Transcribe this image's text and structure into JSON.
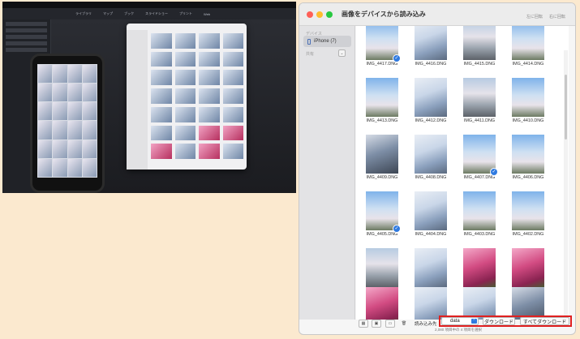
{
  "desk_photo": {
    "toolbar_items": [
      "ライブラリ",
      "マップ",
      "ブック",
      "スライドショー",
      "プリント",
      "Web"
    ]
  },
  "dialog": {
    "title": "画像をデバイスから読み込み",
    "rotate_left": "左に回転",
    "rotate_right": "右に回転",
    "sidebar": {
      "heading": "デバイス",
      "device_label": "iPhone (7)",
      "share_heading": "共有",
      "share_button": "⌄"
    },
    "photos": [
      {
        "name": "IMG_4417.DNG",
        "style": "tn-sky",
        "checked": true
      },
      {
        "name": "IMG_4416.DNG",
        "style": "tn-blossom",
        "checked": false
      },
      {
        "name": "IMG_4415.DNG",
        "style": "tn-street",
        "checked": false
      },
      {
        "name": "IMG_4414.DNG",
        "style": "tn-sky",
        "checked": false
      },
      {
        "name": "IMG_4413.DNG",
        "style": "tn-sky",
        "checked": false
      },
      {
        "name": "IMG_4412.DNG",
        "style": "tn-blossom",
        "checked": false
      },
      {
        "name": "IMG_4411.DNG",
        "style": "tn-street",
        "checked": false
      },
      {
        "name": "IMG_4410.DNG",
        "style": "tn-sky",
        "checked": false
      },
      {
        "name": "IMG_4409.DNG",
        "style": "tn-dark",
        "checked": false
      },
      {
        "name": "IMG_4408.DNG",
        "style": "tn-blossom",
        "checked": false
      },
      {
        "name": "IMG_4407.DNG",
        "style": "tn-sky",
        "checked": true
      },
      {
        "name": "IMG_4406.DNG",
        "style": "tn-sky",
        "checked": false
      },
      {
        "name": "IMG_4405.DNG",
        "style": "tn-sky",
        "checked": true
      },
      {
        "name": "IMG_4404.DNG",
        "style": "tn-blossom",
        "checked": false
      },
      {
        "name": "IMG_4403.DNG",
        "style": "tn-sky",
        "checked": false
      },
      {
        "name": "IMG_4402.DNG",
        "style": "tn-sky",
        "checked": false
      },
      {
        "name": "IMG_4401.DNG",
        "style": "tn-street",
        "checked": false
      },
      {
        "name": "IMG_4400.DNG",
        "style": "tn-blossom",
        "checked": false
      },
      {
        "name": "IMG_4399.DNG",
        "style": "tn-pink",
        "checked": false
      },
      {
        "name": "IMG_4398.DNG",
        "style": "tn-pink",
        "checked": false
      },
      {
        "name": "",
        "style": "tn-pink",
        "checked": false
      },
      {
        "name": "",
        "style": "tn-blossom",
        "checked": false
      },
      {
        "name": "",
        "style": "tn-blossom",
        "checked": false
      },
      {
        "name": "",
        "style": "tn-dark",
        "checked": false
      }
    ],
    "bottom": {
      "import_label": "読み込み先",
      "status": "2,080 項目中の 4 項目を選択",
      "destination_value": "data",
      "download": "ダウンロード",
      "download_all": "すべてダウンロード"
    }
  },
  "colors": {
    "page_bg": "#fbe9cf",
    "highlight": "#e02020",
    "accent": "#2f7ae0"
  }
}
